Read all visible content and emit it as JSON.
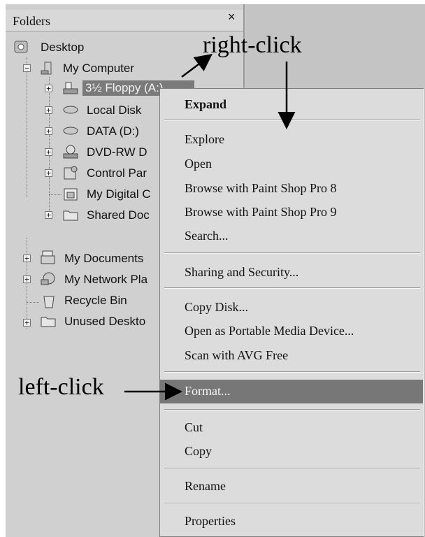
{
  "folders_pane": {
    "title": "Folders",
    "close_glyph": "×",
    "tree": {
      "desktop": "Desktop",
      "my_computer": "My Computer",
      "floppy": "3½ Floppy (A:)",
      "local_disk": "Local Disk",
      "data": "DATA (D:)",
      "dvd": "DVD-RW D",
      "control_panel": "Control Par",
      "my_digital": "My Digital C",
      "shared_docs": "Shared Doc",
      "my_documents": "My Documents",
      "my_network": "My Network Pla",
      "recycle_bin": "Recycle Bin",
      "unused_desktop": "Unused Deskto"
    }
  },
  "annotations": {
    "right_click": "right-click",
    "left_click": "left-click"
  },
  "context_menu": {
    "expand": "Expand",
    "explore": "Explore",
    "open": "Open",
    "browse8": "Browse with Paint Shop Pro 8",
    "browse9": "Browse with Paint Shop Pro 9",
    "search": "Search...",
    "sharing": "Sharing and Security...",
    "copy_disk": "Copy Disk...",
    "portable": "Open as Portable Media Device...",
    "avg": "Scan with AVG Free",
    "format": "Format...",
    "cut": "Cut",
    "copy": "Copy",
    "rename": "Rename",
    "properties": "Properties"
  },
  "colors": {
    "highlight": "#777777",
    "menu_bg": "#dcdcdc",
    "pane_bg": "#d0d0d0"
  }
}
